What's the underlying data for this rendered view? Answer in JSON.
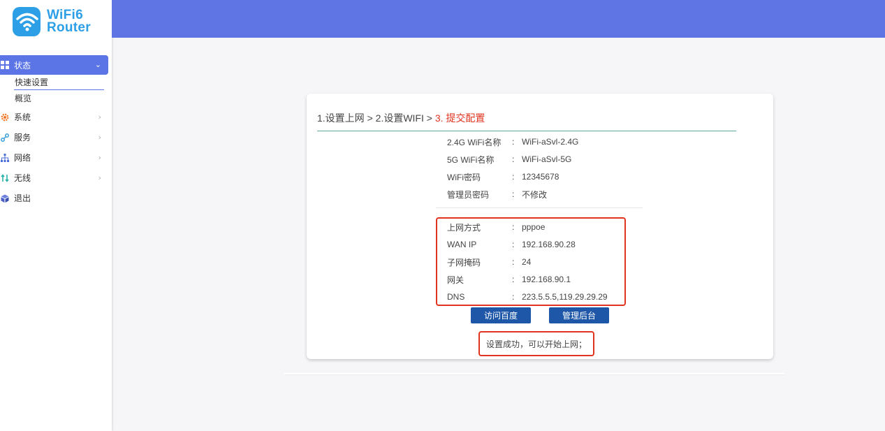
{
  "brand": {
    "line1": "WiFi6",
    "line2": "Router",
    "color": "#2c9fe6"
  },
  "colors": {
    "accent": "#5b75e6",
    "header": "#5f75e3",
    "highlight": "#e0341f",
    "button": "#1e57a8"
  },
  "sidebar": {
    "status": {
      "label": "状态",
      "icon": "dashboard-icon"
    },
    "sub_items": [
      {
        "label": "快速设置"
      },
      {
        "label": "概览"
      }
    ],
    "items": [
      {
        "label": "系统",
        "icon": "gear-icon"
      },
      {
        "label": "服务",
        "icon": "link-icon"
      },
      {
        "label": "网络",
        "icon": "network-icon"
      },
      {
        "label": "无线",
        "icon": "wireless-icon"
      },
      {
        "label": "退出",
        "icon": "cube-icon"
      }
    ]
  },
  "wizard": {
    "step1": "1.设置上网",
    "sep": " > ",
    "step2": "2.设置WIFI",
    "step3": "3. 提交配置"
  },
  "wifi_info": [
    {
      "label": "2.4G WiFi名称",
      "value": "WiFi-aSvl-2.4G"
    },
    {
      "label": "5G WiFi名称",
      "value": "WiFi-aSvl-5G"
    },
    {
      "label": "WiFi密码",
      "value": "12345678"
    },
    {
      "label": "管理员密码",
      "value": "不修改"
    }
  ],
  "net_info": [
    {
      "label": "上网方式",
      "value": "pppoe"
    },
    {
      "label": "WAN IP",
      "value": "192.168.90.28"
    },
    {
      "label": "子网掩码",
      "value": "24"
    },
    {
      "label": "网关",
      "value": "192.168.90.1"
    },
    {
      "label": "DNS",
      "value": "223.5.5.5,119.29.29.29"
    }
  ],
  "separator": ":",
  "buttons": {
    "visit": "访问百度",
    "admin": "管理后台"
  },
  "success_message": "设置成功，可以开始上网；"
}
